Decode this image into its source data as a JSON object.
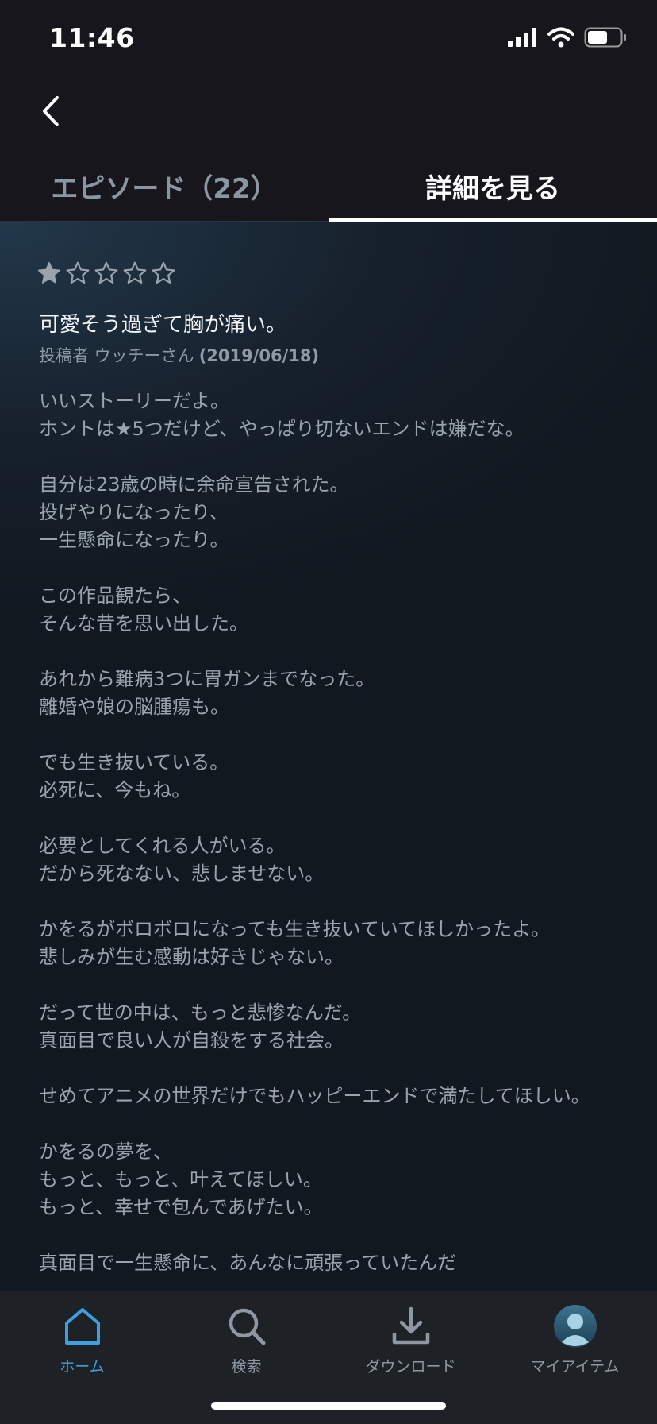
{
  "status_bar": {
    "time": "11:46"
  },
  "nav": {
    "back_icon": "chevron-left-icon"
  },
  "tabs": [
    {
      "label": "エピソード（22）",
      "selected": false
    },
    {
      "label": "詳細を見る",
      "selected": true
    }
  ],
  "review": {
    "rating": 1,
    "max_rating": 5,
    "title": "可愛そう過ぎて胸が痛い。",
    "author": "投稿者 ウッチーさん",
    "date": "(2019/06/18)",
    "paragraphs": [
      "いいストーリーだよ。\nホントは★5つだけど、やっぱり切ないエンドは嫌だな。",
      "自分は23歳の時に余命宣告された。\n投げやりになったり、\n一生懸命になったり。",
      "この作品観たら、\nそんな昔を思い出した。",
      "あれから難病3つに胃ガンまでなった。\n離婚や娘の脳腫瘍も。",
      "でも生き抜いている。\n必死に、今もね。",
      "必要としてくれる人がいる。\nだから死なない、悲しませない。",
      "かをるがボロボロになっても生き抜いていてほしかったよ。\n悲しみが生む感動は好きじゃない。",
      "だって世の中は、もっと悲惨なんだ。\n真面目で良い人が自殺をする社会。",
      "せめてアニメの世界だけでもハッピーエンドで満たしてほしい。",
      "かをるの夢を、\nもっと、もっと、叶えてほしい。\nもっと、幸せで包んであげたい。",
      "真面目で一生懸命に、あんなに頑張っていたんだ"
    ]
  },
  "bottom_nav": [
    {
      "label": "ホーム",
      "icon": "home-icon",
      "active": true
    },
    {
      "label": "検索",
      "icon": "search-icon",
      "active": false
    },
    {
      "label": "ダウンロード",
      "icon": "download-icon",
      "active": false
    },
    {
      "label": "マイアイテム",
      "icon": "avatar-icon",
      "active": false
    }
  ],
  "colors": {
    "accent": "#3d9fe0",
    "background": "#17161c",
    "text_muted": "#9aa4ae"
  }
}
